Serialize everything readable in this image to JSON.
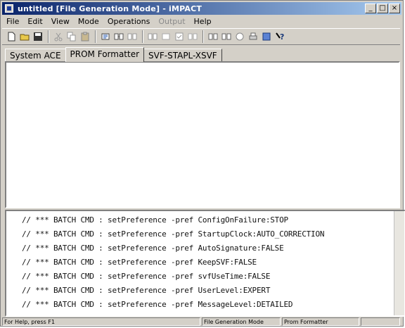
{
  "window": {
    "title": "untitled [File Generation Mode] - iMPACT",
    "minimize_label": "_",
    "maximize_label": "□",
    "close_label": "×"
  },
  "menu": [
    {
      "label": "File",
      "enabled": true
    },
    {
      "label": "Edit",
      "enabled": true
    },
    {
      "label": "View",
      "enabled": true
    },
    {
      "label": "Mode",
      "enabled": true
    },
    {
      "label": "Operations",
      "enabled": true
    },
    {
      "label": "Output",
      "enabled": false
    },
    {
      "label": "Help",
      "enabled": true
    }
  ],
  "tabs": [
    {
      "label": "System ACE",
      "active": false
    },
    {
      "label": "PROM Formatter",
      "active": true
    },
    {
      "label": "SVF-STAPL-XSVF",
      "active": false
    }
  ],
  "console": {
    "lines": [
      "// *** BATCH CMD : setPreference -pref ConfigOnFailure:STOP",
      "// *** BATCH CMD : setPreference -pref StartupClock:AUTO_CORRECTION",
      "// *** BATCH CMD : setPreference -pref AutoSignature:FALSE",
      "// *** BATCH CMD : setPreference -pref KeepSVF:FALSE",
      "// *** BATCH CMD : setPreference -pref svfUseTime:FALSE",
      "// *** BATCH CMD : setPreference -pref UserLevel:EXPERT",
      "// *** BATCH CMD : setPreference -pref MessageLevel:DETAILED"
    ]
  },
  "status": {
    "help": "For Help, press F1",
    "mode": "File Generation Mode",
    "view": "Prom Formatter"
  }
}
